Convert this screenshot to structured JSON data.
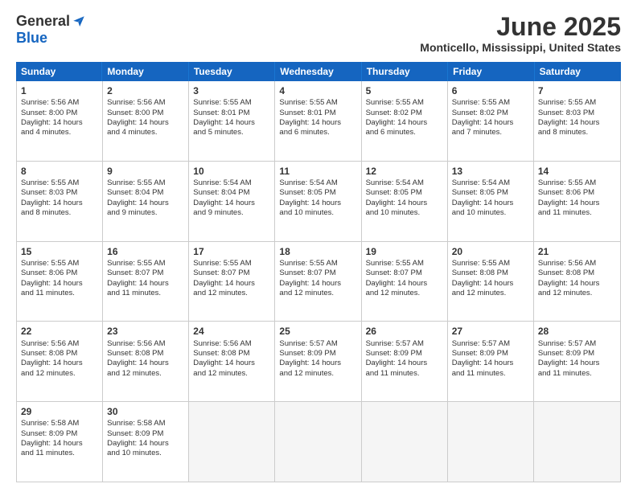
{
  "logo": {
    "general": "General",
    "blue": "Blue"
  },
  "title": {
    "month": "June 2025",
    "location": "Monticello, Mississippi, United States"
  },
  "header": {
    "days": [
      "Sunday",
      "Monday",
      "Tuesday",
      "Wednesday",
      "Thursday",
      "Friday",
      "Saturday"
    ]
  },
  "weeks": [
    {
      "cells": [
        {
          "day": "1",
          "info": "Sunrise: 5:56 AM\nSunset: 8:00 PM\nDaylight: 14 hours\nand 4 minutes."
        },
        {
          "day": "2",
          "info": "Sunrise: 5:56 AM\nSunset: 8:00 PM\nDaylight: 14 hours\nand 4 minutes."
        },
        {
          "day": "3",
          "info": "Sunrise: 5:55 AM\nSunset: 8:01 PM\nDaylight: 14 hours\nand 5 minutes."
        },
        {
          "day": "4",
          "info": "Sunrise: 5:55 AM\nSunset: 8:01 PM\nDaylight: 14 hours\nand 6 minutes."
        },
        {
          "day": "5",
          "info": "Sunrise: 5:55 AM\nSunset: 8:02 PM\nDaylight: 14 hours\nand 6 minutes."
        },
        {
          "day": "6",
          "info": "Sunrise: 5:55 AM\nSunset: 8:02 PM\nDaylight: 14 hours\nand 7 minutes."
        },
        {
          "day": "7",
          "info": "Sunrise: 5:55 AM\nSunset: 8:03 PM\nDaylight: 14 hours\nand 8 minutes."
        }
      ]
    },
    {
      "cells": [
        {
          "day": "8",
          "info": "Sunrise: 5:55 AM\nSunset: 8:03 PM\nDaylight: 14 hours\nand 8 minutes."
        },
        {
          "day": "9",
          "info": "Sunrise: 5:55 AM\nSunset: 8:04 PM\nDaylight: 14 hours\nand 9 minutes."
        },
        {
          "day": "10",
          "info": "Sunrise: 5:54 AM\nSunset: 8:04 PM\nDaylight: 14 hours\nand 9 minutes."
        },
        {
          "day": "11",
          "info": "Sunrise: 5:54 AM\nSunset: 8:05 PM\nDaylight: 14 hours\nand 10 minutes."
        },
        {
          "day": "12",
          "info": "Sunrise: 5:54 AM\nSunset: 8:05 PM\nDaylight: 14 hours\nand 10 minutes."
        },
        {
          "day": "13",
          "info": "Sunrise: 5:54 AM\nSunset: 8:05 PM\nDaylight: 14 hours\nand 10 minutes."
        },
        {
          "day": "14",
          "info": "Sunrise: 5:55 AM\nSunset: 8:06 PM\nDaylight: 14 hours\nand 11 minutes."
        }
      ]
    },
    {
      "cells": [
        {
          "day": "15",
          "info": "Sunrise: 5:55 AM\nSunset: 8:06 PM\nDaylight: 14 hours\nand 11 minutes."
        },
        {
          "day": "16",
          "info": "Sunrise: 5:55 AM\nSunset: 8:07 PM\nDaylight: 14 hours\nand 11 minutes."
        },
        {
          "day": "17",
          "info": "Sunrise: 5:55 AM\nSunset: 8:07 PM\nDaylight: 14 hours\nand 12 minutes."
        },
        {
          "day": "18",
          "info": "Sunrise: 5:55 AM\nSunset: 8:07 PM\nDaylight: 14 hours\nand 12 minutes."
        },
        {
          "day": "19",
          "info": "Sunrise: 5:55 AM\nSunset: 8:07 PM\nDaylight: 14 hours\nand 12 minutes."
        },
        {
          "day": "20",
          "info": "Sunrise: 5:55 AM\nSunset: 8:08 PM\nDaylight: 14 hours\nand 12 minutes."
        },
        {
          "day": "21",
          "info": "Sunrise: 5:56 AM\nSunset: 8:08 PM\nDaylight: 14 hours\nand 12 minutes."
        }
      ]
    },
    {
      "cells": [
        {
          "day": "22",
          "info": "Sunrise: 5:56 AM\nSunset: 8:08 PM\nDaylight: 14 hours\nand 12 minutes."
        },
        {
          "day": "23",
          "info": "Sunrise: 5:56 AM\nSunset: 8:08 PM\nDaylight: 14 hours\nand 12 minutes."
        },
        {
          "day": "24",
          "info": "Sunrise: 5:56 AM\nSunset: 8:08 PM\nDaylight: 14 hours\nand 12 minutes."
        },
        {
          "day": "25",
          "info": "Sunrise: 5:57 AM\nSunset: 8:09 PM\nDaylight: 14 hours\nand 12 minutes."
        },
        {
          "day": "26",
          "info": "Sunrise: 5:57 AM\nSunset: 8:09 PM\nDaylight: 14 hours\nand 11 minutes."
        },
        {
          "day": "27",
          "info": "Sunrise: 5:57 AM\nSunset: 8:09 PM\nDaylight: 14 hours\nand 11 minutes."
        },
        {
          "day": "28",
          "info": "Sunrise: 5:57 AM\nSunset: 8:09 PM\nDaylight: 14 hours\nand 11 minutes."
        }
      ]
    },
    {
      "cells": [
        {
          "day": "29",
          "info": "Sunrise: 5:58 AM\nSunset: 8:09 PM\nDaylight: 14 hours\nand 11 minutes."
        },
        {
          "day": "30",
          "info": "Sunrise: 5:58 AM\nSunset: 8:09 PM\nDaylight: 14 hours\nand 10 minutes."
        },
        {
          "day": "",
          "info": ""
        },
        {
          "day": "",
          "info": ""
        },
        {
          "day": "",
          "info": ""
        },
        {
          "day": "",
          "info": ""
        },
        {
          "day": "",
          "info": ""
        }
      ]
    }
  ]
}
